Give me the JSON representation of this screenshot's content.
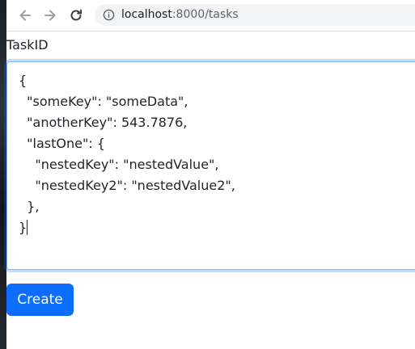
{
  "browser": {
    "url_host": "localhost",
    "url_rest": ":8000/tasks",
    "icons": [
      "back-arrow-icon",
      "forward-arrow-icon",
      "reload-icon",
      "info-icon"
    ]
  },
  "form": {
    "label": "TaskID",
    "textarea_lines": [
      "{",
      "  \"someKey\": \"someData\",",
      "  \"anotherKey\": 543.7876,",
      "  \"lastOne\": {",
      "    \"nestedKey\": \"nestedValue\",",
      "    \"nestedKey2\": \"nestedValue2\",",
      "  },",
      "}"
    ],
    "submit_label": "Create"
  },
  "colors": {
    "primary": "#0d6efd",
    "focus_border": "#86b7fe",
    "text": "#212529",
    "omnibox_bg": "#f1f3f4"
  }
}
